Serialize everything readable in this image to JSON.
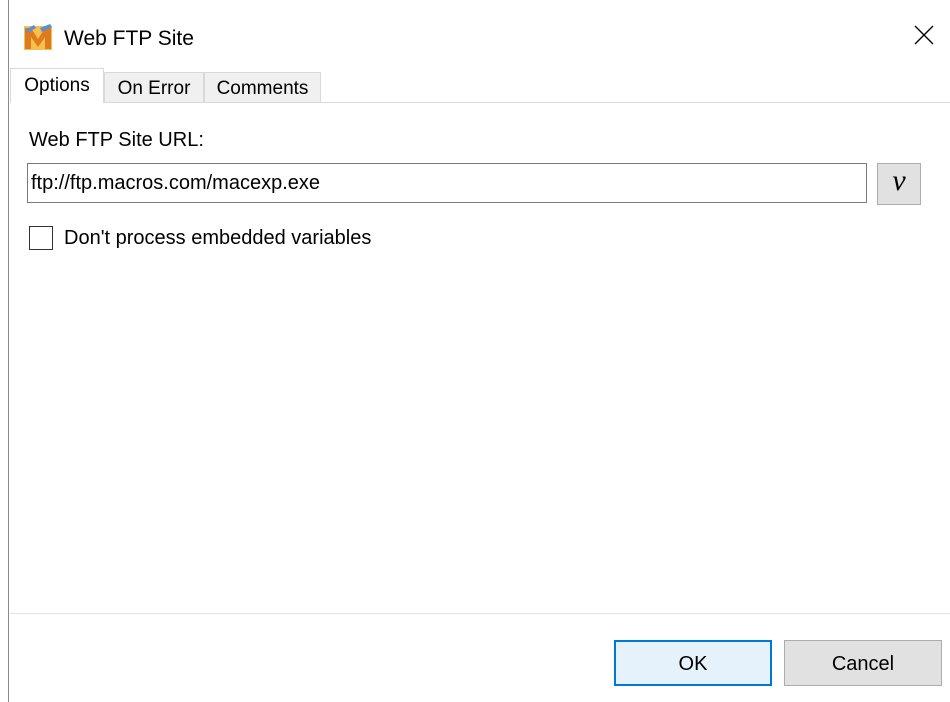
{
  "window": {
    "title": "Web FTP Site",
    "icon": "macro-express-icon",
    "close_glyph": "✕"
  },
  "tabs": [
    {
      "label": "Options",
      "active": true
    },
    {
      "label": "On Error",
      "active": false
    },
    {
      "label": "Comments",
      "active": false
    }
  ],
  "options": {
    "url_label": "Web FTP Site URL:",
    "url_value": "ftp://ftp.macros.com/macexp.exe",
    "variable_button_label": "v",
    "checkbox_label": "Don't process embedded variables",
    "checkbox_checked": false
  },
  "footer": {
    "ok_label": "OK",
    "cancel_label": "Cancel"
  },
  "colors": {
    "accent": "#0078d7",
    "button_face": "#e1e1e1",
    "tab_inactive": "#f0f0f0"
  }
}
